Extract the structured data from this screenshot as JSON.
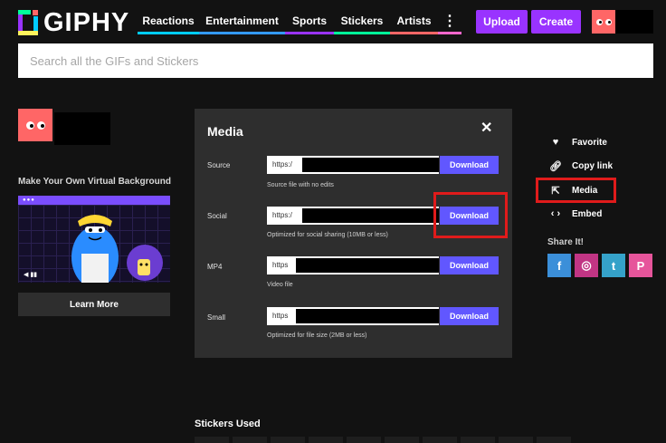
{
  "header": {
    "logo_text": "GIPHY",
    "nav": [
      {
        "label": "Reactions",
        "color": "#00ccff"
      },
      {
        "label": "Entertainment",
        "color": "#3399ff"
      },
      {
        "label": "Sports",
        "color": "#9933ff"
      },
      {
        "label": "Stickers",
        "color": "#00ff99"
      },
      {
        "label": "Artists",
        "color": "#ff6666"
      },
      {
        "label": "⋮",
        "color": "#ff66cc"
      }
    ],
    "upload_label": "Upload",
    "create_label": "Create"
  },
  "search": {
    "placeholder": "Search all the GIFs and Stickers"
  },
  "sidebar_left": {
    "vb_title": "Make Your Own Virtual Background",
    "learn_more": "Learn More"
  },
  "media_panel": {
    "title": "Media",
    "close_label": "✕",
    "rows": [
      {
        "label": "Source",
        "value": "https:/",
        "button": "Download",
        "desc": "Source file with no edits"
      },
      {
        "label": "Social",
        "value": "https:/",
        "button": "Download",
        "desc": "Optimized for social sharing (10MB or less)"
      },
      {
        "label": "MP4",
        "value": "https",
        "button": "Download",
        "desc": "Video file"
      },
      {
        "label": "Small",
        "value": "https",
        "button": "Download",
        "desc": "Optimized for file size (2MB or less)"
      }
    ]
  },
  "sidebar_right": {
    "actions": [
      {
        "label": "Favorite",
        "icon": "heart-icon"
      },
      {
        "label": "Copy link",
        "icon": "link-icon"
      },
      {
        "label": "Media",
        "icon": "share-out-icon"
      },
      {
        "label": "Embed",
        "icon": "code-icon"
      }
    ],
    "share_title": "Share It!",
    "share": [
      {
        "glyph": "f",
        "name": "facebook-icon",
        "color": "#3b8fd9"
      },
      {
        "glyph": "◎",
        "name": "instagram-icon",
        "color": "#c13584"
      },
      {
        "glyph": "t",
        "name": "tumblr-icon",
        "color": "#35a2c9"
      },
      {
        "glyph": "P",
        "name": "pinterest-icon",
        "color": "#e6559b"
      }
    ]
  },
  "stickers_title": "Stickers Used",
  "colors": {
    "accent": "#9933ff",
    "download": "#6157ff",
    "highlight": "#e01b1b"
  }
}
